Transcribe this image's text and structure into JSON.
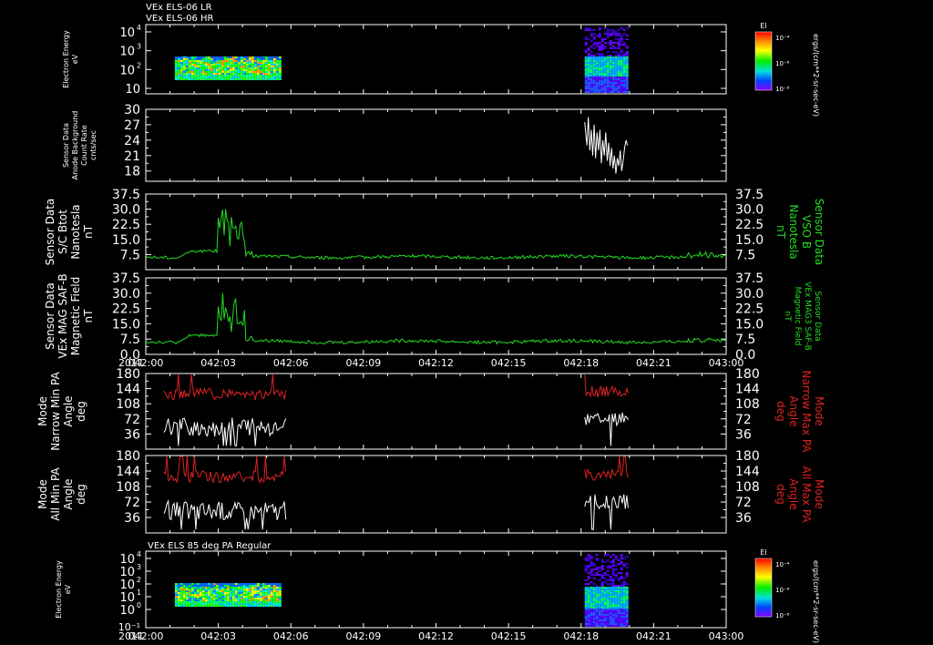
{
  "header": {
    "line1": "VEx ELS-06 LR",
    "line2": "VEx ELS-06 HR"
  },
  "colors": {
    "frame": "#ffffff",
    "green": "#22dd22",
    "red": "#dd2222",
    "white_trace": "#ffffff",
    "background": "#000000"
  },
  "x_axis": {
    "year_label": "2011",
    "ticks": [
      "042:00",
      "042:03",
      "042:06",
      "042:09",
      "042:12",
      "042:15",
      "042:18",
      "042:21",
      "043:00"
    ]
  },
  "chart_data": [
    {
      "type": "heatmap",
      "title": "",
      "ylabel_lines": [
        "Electron Energy",
        "eV"
      ],
      "yticks_main": [
        "10",
        "10",
        "10",
        "10"
      ],
      "yticks_exp": [
        "4",
        "3",
        "2",
        ""
      ],
      "ytick_values": [
        10000,
        1000,
        100,
        10
      ],
      "yscale": "log",
      "colorbar": {
        "label": "El",
        "ticks": [
          "10⁻⁴",
          "10⁻⁶",
          "10⁻⁸"
        ],
        "units": "ergs/(cm**2-sr-sec-eV)"
      },
      "coverage": [
        {
          "x_start": 0.4,
          "x_end": 1.85
        },
        {
          "x_start": 6.05,
          "x_end": 6.65
        }
      ]
    },
    {
      "type": "line",
      "ylabel_lines": [
        "Sensor Data",
        "Anode Background",
        "Count Rate",
        "cnts/sec"
      ],
      "yticks": [
        "30",
        "27",
        "24",
        "21",
        "18"
      ],
      "ylim": [
        16,
        30
      ],
      "series": [
        {
          "color": "white",
          "x": [
            6.05,
            6.08,
            6.1,
            6.12,
            6.14,
            6.16,
            6.18,
            6.2,
            6.22,
            6.24,
            6.26,
            6.28,
            6.3,
            6.32,
            6.34,
            6.36,
            6.38,
            6.4,
            6.42,
            6.44,
            6.46,
            6.48,
            6.5,
            6.52,
            6.54,
            6.56,
            6.58,
            6.6,
            6.62,
            6.64
          ],
          "y": [
            27.5,
            23,
            28.5,
            22,
            26,
            21,
            27,
            20.5,
            25.5,
            22,
            26,
            19.5,
            24,
            21,
            25.5,
            20,
            23.5,
            19,
            22.5,
            18.5,
            21,
            17.5,
            20.5,
            19,
            22,
            18,
            20,
            22.5,
            24,
            23
          ]
        }
      ]
    },
    {
      "type": "line",
      "ylabel_lines": [
        "Sensor Data",
        "S/C Btot",
        "Nanotesla",
        "nT"
      ],
      "ylabel_right_lines": [
        "Sensor Data",
        "VSO B",
        "Nanotesla",
        "nT"
      ],
      "yticks": [
        "37.5",
        "30.0",
        "22.5",
        "15.0",
        "7.5"
      ],
      "ylim": [
        0,
        37.5
      ],
      "series": [
        {
          "color": "green",
          "shape": "mag"
        }
      ]
    },
    {
      "type": "line",
      "ylabel_lines": [
        "Sensor Data",
        "VEx MAG SAF-B",
        "Magnetic Field",
        "nT"
      ],
      "ylabel_right_lines": [
        "Sensor Data",
        "VEx MAG3 SAF-B",
        "Magnetic Field",
        "nT"
      ],
      "yticks": [
        "37.5",
        "30.0",
        "22.5",
        "15.0",
        "7.5",
        "0.0"
      ],
      "ylim": [
        0,
        37.5
      ],
      "series": [
        {
          "color": "green",
          "shape": "mag"
        }
      ]
    },
    {
      "type": "line",
      "ylabel_lines": [
        "Mode",
        "Narrow Min PA",
        "Angle",
        "deg"
      ],
      "ylabel_right_lines": [
        "Mode",
        "Narrow Max PA",
        "Angle",
        "deg"
      ],
      "yticks": [
        "180",
        "144",
        "108",
        "72",
        "36"
      ],
      "ylim": [
        0,
        180
      ],
      "series": [
        {
          "name": "",
          "color": "red",
          "shape": "pa_max"
        },
        {
          "name": "",
          "color": "white",
          "shape": "pa_min"
        }
      ]
    },
    {
      "type": "line",
      "ylabel_lines": [
        "Mode",
        "All Min PA",
        "Angle",
        "deg"
      ],
      "ylabel_right_lines": [
        "Mode",
        "All Max PA",
        "Angle",
        "deg"
      ],
      "yticks": [
        "180",
        "144",
        "108",
        "72",
        "36"
      ],
      "ylim": [
        0,
        180
      ],
      "series": [
        {
          "color": "red",
          "shape": "pa_max"
        },
        {
          "color": "white",
          "shape": "pa_min"
        }
      ]
    },
    {
      "type": "heatmap",
      "title": "VEx ELS 85 deg PA Regular",
      "ylabel_lines": [
        "Electron Energy",
        "eV"
      ],
      "yticks_main": [
        "10",
        "10",
        "10",
        "10",
        "10"
      ],
      "yticks_exp": [
        "4",
        "3",
        "2",
        "1",
        "0"
      ],
      "ytick_values": [
        10000,
        1000,
        100,
        10,
        1
      ],
      "ytick_extra": "10⁻¹",
      "yscale": "log",
      "colorbar": {
        "label": "El",
        "ticks": [
          "10⁻⁴",
          "10⁻⁶",
          "10⁻⁸"
        ],
        "units": "ergs/(cm**2-sr-sec-eV)"
      },
      "coverage": [
        {
          "x_start": 0.4,
          "x_end": 1.85
        },
        {
          "x_start": 6.05,
          "x_end": 6.65
        }
      ]
    }
  ]
}
